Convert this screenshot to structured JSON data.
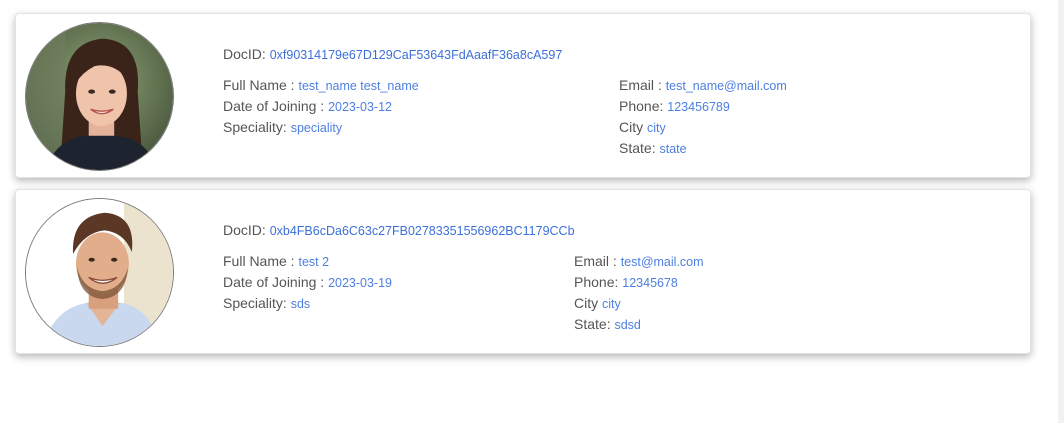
{
  "labels": {
    "docid": "DocID:",
    "full_name": "Full Name :",
    "date_of_joining": "Date of Joining :",
    "speciality": "Speciality:",
    "email": "Email :",
    "phone": "Phone:",
    "city": "City",
    "state": "State:"
  },
  "doctors": [
    {
      "docid": "0xf90314179e67D129CaF53643FdAaafF36a8cA597",
      "full_name": "test_name test_name",
      "date_of_joining": "2023-03-12",
      "speciality": "speciality",
      "email": "test_name@mail.com",
      "phone": "123456789",
      "city": "city",
      "state": "state",
      "avatar_icon": "doctor-portrait-woman"
    },
    {
      "docid": "0xb4FB6cDa6C63c27FB02783351556962BC1179CCb",
      "full_name": "test 2",
      "date_of_joining": "2023-03-19",
      "speciality": "sds",
      "email": "test@mail.com",
      "phone": "12345678",
      "city": "city",
      "state": "sdsd",
      "avatar_icon": "doctor-portrait-man"
    }
  ],
  "colors": {
    "value_text": "#4d7fe0",
    "label_text": "#555555",
    "card_border": "#e3e3e3"
  }
}
